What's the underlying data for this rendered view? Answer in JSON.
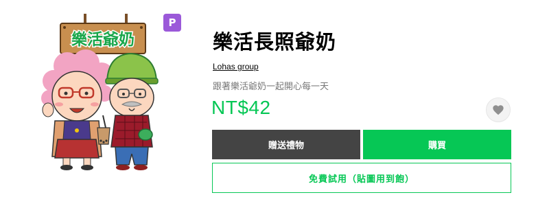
{
  "sticker": {
    "title": "樂活長照爺奶",
    "author": "Lohas group",
    "description": "跟著樂活爺奶一起開心每一天",
    "price": "NT$42",
    "premium_badge": "P",
    "art_sign_text": "樂活爺奶"
  },
  "actions": {
    "gift_label": "贈送禮物",
    "buy_label": "購買",
    "trial_label": "免費試用（貼圖用到飽）"
  },
  "icons": {
    "favorite": "heart-icon"
  },
  "colors": {
    "accent_green": "#06c755",
    "gift_button": "#444444",
    "premium_badge": "#9b59d9",
    "description_text": "#777777",
    "sign_green": "#19a64a"
  }
}
